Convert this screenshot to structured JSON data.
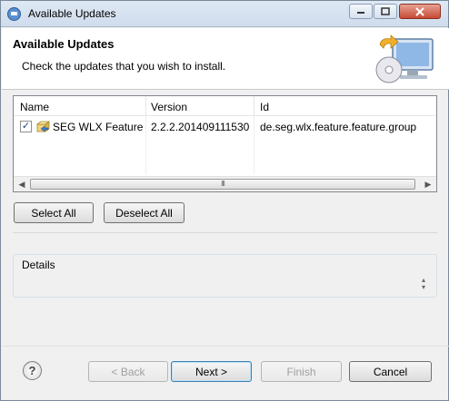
{
  "window": {
    "title": "Available Updates",
    "controls": {
      "minimize": "",
      "maximize": "",
      "close": ""
    }
  },
  "header": {
    "title": "Available Updates",
    "description": "Check the updates that you wish to install."
  },
  "table": {
    "columns": [
      "Name",
      "Version",
      "Id"
    ],
    "rows": [
      {
        "checked": true,
        "name": "SEG WLX Feature",
        "version": "2.2.2.201409111530",
        "id": "de.seg.wlx.feature.feature.group"
      }
    ],
    "scrollbar_thumb_grip": "III"
  },
  "buttons": {
    "select_all": "Select All",
    "deselect_all": "Deselect All",
    "back": "< Back",
    "next": "Next >",
    "finish": "Finish",
    "cancel": "Cancel"
  },
  "details": {
    "label": "Details"
  },
  "help_icon_glyph": "?",
  "icons": {
    "window_icon": "eclipse-window-icon",
    "header_image": "computer-update-icon",
    "row_icon": "feature-package-icon"
  },
  "colors": {
    "title_bar": "#cfdcec",
    "default_button_border": "#3c7fb1",
    "close_button": "#c64a35"
  }
}
